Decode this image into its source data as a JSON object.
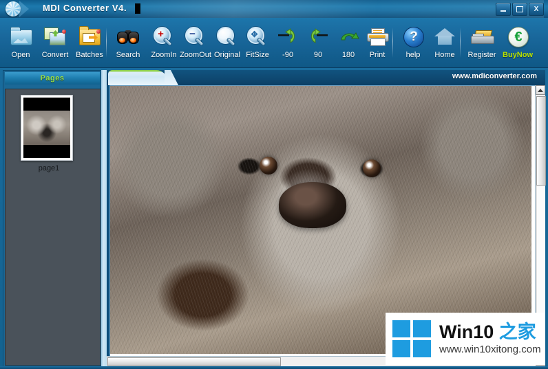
{
  "window": {
    "title": "MDI Converter V4.",
    "app_icon": "globe-sphere-icon",
    "controls": {
      "minimize": "minimize-icon",
      "maximize": "maximize-icon",
      "close": "X"
    }
  },
  "toolbar": {
    "buttons": [
      {
        "label": "Open",
        "icon": "open-folder-icon"
      },
      {
        "label": "Convert",
        "icon": "convert-images-icon"
      },
      {
        "label": "Batches",
        "icon": "batch-folder-icon"
      },
      {
        "label": "Search",
        "icon": "binoculars-icon"
      },
      {
        "label": "ZoomIn",
        "icon": "magnifier-plus-icon"
      },
      {
        "label": "ZoomOut",
        "icon": "magnifier-minus-icon"
      },
      {
        "label": "Original",
        "icon": "magnifier-original-icon"
      },
      {
        "label": "FitSize",
        "icon": "magnifier-fit-icon"
      },
      {
        "label": "-90",
        "icon": "rotate-left-icon"
      },
      {
        "label": "90",
        "icon": "rotate-right-icon"
      },
      {
        "label": "180",
        "icon": "rotate-180-icon"
      },
      {
        "label": "Print",
        "icon": "printer-icon"
      },
      {
        "label": "help",
        "icon": "question-circle-icon"
      },
      {
        "label": "Home",
        "icon": "house-icon"
      },
      {
        "label": "Register",
        "icon": "cash-register-icon"
      },
      {
        "label": "BuyNow",
        "icon": "euro-coin-icon"
      }
    ],
    "buy_now_color": "#b8e000"
  },
  "sidebar": {
    "header": "Pages",
    "header_color": "#9ee040",
    "pages": [
      {
        "label": "page1",
        "thumbnail": "koala-thumbnail"
      }
    ]
  },
  "viewer": {
    "url": "www.mdiconverter.com",
    "image_alt": "koala-photo",
    "scrollbars": {
      "vertical_arrow_up": "arrow-up-icon",
      "horizontal": "horizontal-scrollbar"
    }
  },
  "watermark": {
    "logo": "windows-logo-icon",
    "title_main": "Win10 ",
    "title_cn": "之家",
    "url": "www.win10xitong.com",
    "accent_color": "#1e9ce0"
  }
}
